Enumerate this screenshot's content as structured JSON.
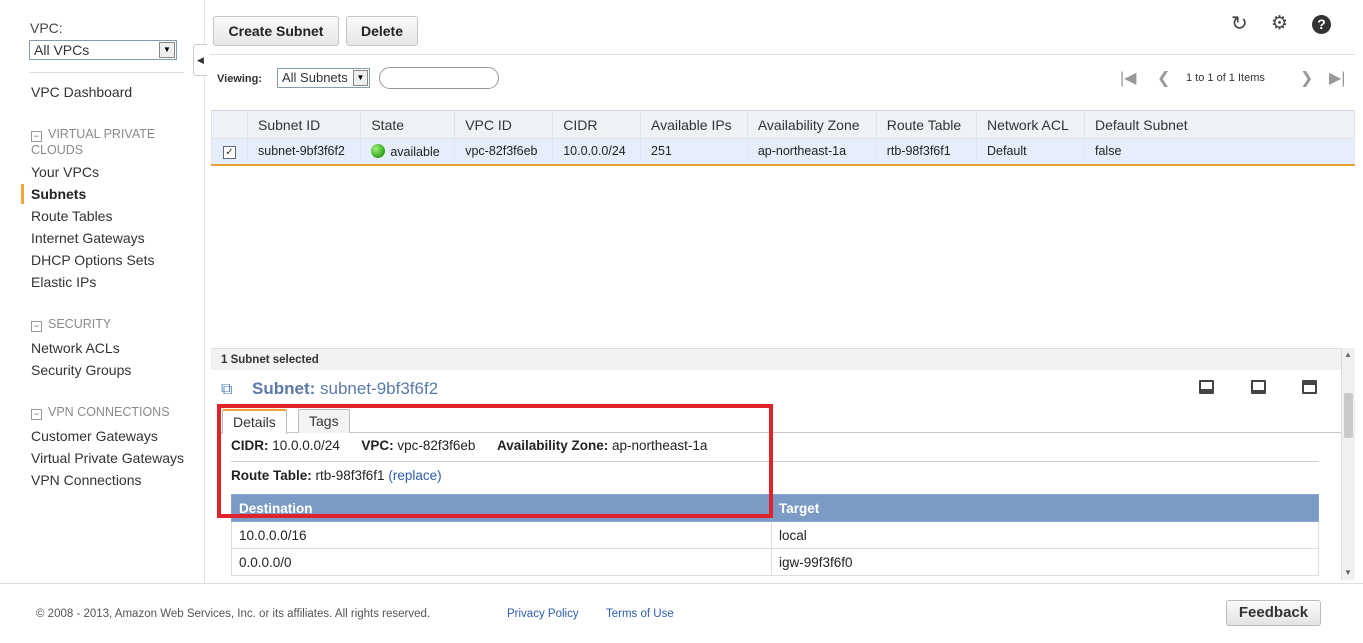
{
  "sidebar": {
    "vpc_label": "VPC:",
    "vpc_select_value": "All VPCs",
    "dashboard": "VPC Dashboard",
    "section_vpc": "VIRTUAL PRIVATE CLOUDS",
    "vpc_items": [
      "Your VPCs",
      "Subnets",
      "Route Tables",
      "Internet Gateways",
      "DHCP Options Sets",
      "Elastic IPs"
    ],
    "section_security": "SECURITY",
    "security_items": [
      "Network ACLs",
      "Security Groups"
    ],
    "section_vpn": "VPN CONNECTIONS",
    "vpn_items": [
      "Customer Gateways",
      "Virtual Private Gateways",
      "VPN Connections"
    ],
    "active_item": "Subnets"
  },
  "toolbar": {
    "create_label": "Create Subnet",
    "delete_label": "Delete"
  },
  "viewing": {
    "label": "Viewing:",
    "select_value": "All Subnets",
    "search_value": "",
    "pager_text": "1 to 1 of 1 Items"
  },
  "grid": {
    "columns": [
      "Subnet ID",
      "State",
      "VPC ID",
      "CIDR",
      "Available IPs",
      "Availability Zone",
      "Route Table",
      "Network ACL",
      "Default Subnet"
    ],
    "rows": [
      {
        "selected": true,
        "subnet_id": "subnet-9bf3f6f2",
        "state": "available",
        "vpc_id": "vpc-82f3f6eb",
        "cidr": "10.0.0.0/24",
        "available_ips": "251",
        "availability_zone": "ap-northeast-1a",
        "route_table": "rtb-98f3f6f1",
        "network_acl": "Default",
        "default_subnet": "false"
      }
    ]
  },
  "details": {
    "header": "1 Subnet selected",
    "title_label": "Subnet:",
    "title_value": "subnet-9bf3f6f2",
    "tabs": [
      "Details",
      "Tags"
    ],
    "cidr_label": "CIDR:",
    "cidr_value": "10.0.0.0/24",
    "vpc_label": "VPC:",
    "vpc_value": "vpc-82f3f6eb",
    "az_label": "Availability Zone:",
    "az_value": "ap-northeast-1a",
    "route_table_label": "Route Table:",
    "route_table_value": "rtb-98f3f6f1",
    "replace_link": "(replace)",
    "route_columns": [
      "Destination",
      "Target"
    ],
    "routes": [
      {
        "destination": "10.0.0.0/16",
        "target": "local"
      },
      {
        "destination": "0.0.0.0/0",
        "target": "igw-99f3f6f0"
      }
    ]
  },
  "footer": {
    "copyright": "© 2008 - 2013, Amazon Web Services, Inc. or its affiliates. All rights reserved.",
    "privacy_link": "Privacy Policy",
    "terms_link": "Terms of Use",
    "feedback_label": "Feedback"
  },
  "colors": {
    "accent_orange": "#f7a43a",
    "highlight_red": "#e0222b",
    "table_header_blue": "#7b9bc5",
    "link_blue": "#2a5db0"
  },
  "icons": [
    "refresh-icon",
    "gear-icon",
    "help-icon",
    "first-page-icon",
    "prev-page-icon",
    "next-page-icon",
    "last-page-icon",
    "subnet-icon"
  ]
}
